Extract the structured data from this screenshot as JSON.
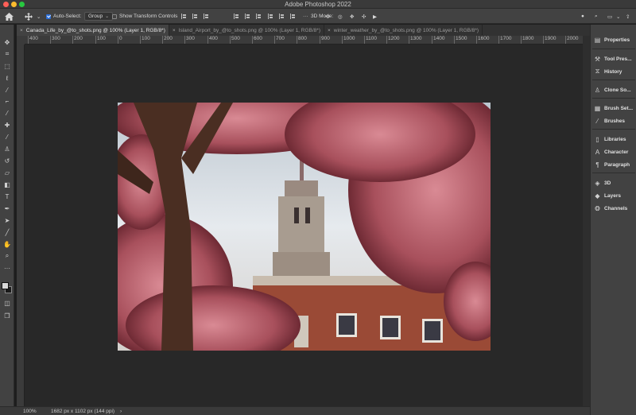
{
  "app": {
    "title": "Adobe Photoshop 2022"
  },
  "options_bar": {
    "auto_select_label": "Auto-Select:",
    "auto_select_checked": true,
    "auto_select_target": "Group",
    "transform_controls_label": "Show Transform Controls",
    "transform_controls_checked": false,
    "mode_3d_label": "3D Mode:"
  },
  "tabs": [
    {
      "label": "Canada_Life_by_@to_shots.png @ 100% (Layer 1, RGB/8*)",
      "active": true
    },
    {
      "label": "Island_Airport_by_@to_shots.png @ 100% (Layer 1, RGB/8*)",
      "active": false
    },
    {
      "label": "winter_weather_by_@to_shots.png @ 100% (Layer 1, RGB/8*)",
      "active": false
    }
  ],
  "ruler": {
    "labels": [
      "400",
      "300",
      "200",
      "100",
      "0",
      "100",
      "200",
      "300",
      "400",
      "500",
      "600",
      "700",
      "800",
      "900",
      "1000",
      "1100",
      "1200",
      "1300",
      "1400",
      "1500",
      "1600",
      "1700",
      "1800",
      "1900",
      "2000"
    ]
  },
  "tools": [
    "move-tool",
    "artboard-tool",
    "marquee-tool",
    "lasso-tool",
    "magic-wand-tool",
    "crop-tool",
    "eyedropper-tool",
    "healing-brush-tool",
    "brush-tool",
    "clone-stamp-tool",
    "history-brush-tool",
    "eraser-tool",
    "gradient-tool",
    "dodge-tool",
    "pen-tool",
    "type-tool",
    "path-selection-tool",
    "rectangle-tool",
    "hand-tool",
    "zoom-tool",
    "more-tools"
  ],
  "colors": {
    "foreground": "#d8d8d8",
    "background": "#1a1a1a",
    "accent": "#2d6fd8"
  },
  "status": {
    "zoom": "100%",
    "doc_info": "1682 px x 1102 px (144 ppi)",
    "arrow": "›"
  },
  "panels": [
    {
      "label": "Properties",
      "icon": "properties-icon"
    },
    {
      "label": "Tool Pres...",
      "icon": "tool-presets-icon"
    },
    {
      "label": "History",
      "icon": "history-icon"
    },
    {
      "label": "Clone So...",
      "icon": "clone-source-icon"
    },
    {
      "label": "Brush Set...",
      "icon": "brush-settings-icon"
    },
    {
      "label": "Brushes",
      "icon": "brushes-icon"
    },
    {
      "label": "Libraries",
      "icon": "libraries-icon"
    },
    {
      "label": "Character",
      "icon": "character-icon"
    },
    {
      "label": "Paragraph",
      "icon": "paragraph-icon"
    },
    {
      "label": "3D",
      "icon": "3d-icon"
    },
    {
      "label": "Layers",
      "icon": "layers-icon"
    },
    {
      "label": "Channels",
      "icon": "channels-icon"
    }
  ]
}
